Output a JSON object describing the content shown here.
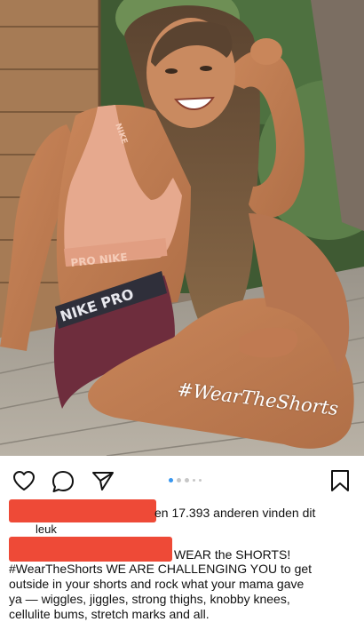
{
  "photo": {
    "overlay_text": "#WearTheShorts",
    "top_brand_text": "NIKE",
    "band_brand_text": "PRO NIKE",
    "shorts_brand_text": "NIKE PRO"
  },
  "actions": {
    "icons": [
      "heart-icon",
      "comment-icon",
      "share-icon",
      "bookmark-icon"
    ],
    "carousel_dots": 5,
    "carousel_active_index": 0,
    "accent_color": "#3897f0"
  },
  "likes": {
    "text": "en 17.393 anderen vinden dit",
    "wrap": "leuk",
    "redaction_color": "#ee4a37"
  },
  "caption": {
    "head": "WEAR the SHORTS!",
    "lines": [
      "#WearTheShorts WE ARE CHALLENGING YOU to get",
      "outside in your shorts and rock what your mama gave",
      "ya — wiggles, jiggles, strong thighs, knobby knees,",
      "cellulite bums, stretch marks and all."
    ]
  }
}
